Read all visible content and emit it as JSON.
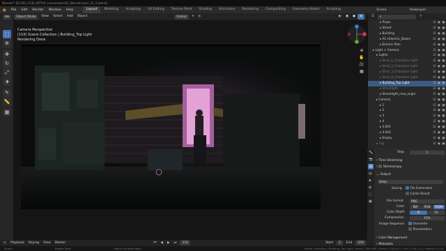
{
  "titlebar": "Blender* [D:\\3D_CG\\B_ARTS\\P_Lemontown\\02_Blender\\Lem_01_5.blend]",
  "menu": [
    "File",
    "Edit",
    "Render",
    "Window",
    "Help"
  ],
  "workspaces": [
    "Layout",
    "Modeling",
    "Sculpting",
    "UV Editing",
    "Texture Paint",
    "Shading",
    "Animation",
    "Rendering",
    "Compositing",
    "Geometry Nodes",
    "Scripting"
  ],
  "active_workspace": "Layout",
  "scene": "Scene",
  "view_layer": "ViewLayer",
  "viewport_header": {
    "mode": "Object Mode",
    "view": "View",
    "select": "Select",
    "add": "Add",
    "object": "Object",
    "orientation": "Global",
    "options": "Options"
  },
  "overlay": {
    "line1": "Camera Perspective",
    "line2": "(110) Scene Collection | Building_Top Light",
    "line3": "Rendering Done"
  },
  "timeline": {
    "playback": "Playback",
    "keying": "Keying",
    "view": "View",
    "marker": "Marker",
    "start_label": "Start",
    "start": "1",
    "end_label": "End",
    "end": "250",
    "current": "110"
  },
  "statusbar": {
    "left": "Select",
    "mid": "Rotate View",
    "mid2": "Object Context Menu",
    "right": "Scene Collection | Building_Top Light | Verts:1,369,485 | Faces:1,258,047 | Tris:2,516,124 | Objects:1/118"
  },
  "outliner": {
    "rows": [
      {
        "name": "Props",
        "indent": 3,
        "state": ""
      },
      {
        "name": "Street",
        "indent": 3,
        "state": ""
      },
      {
        "name": "Building",
        "indent": 3,
        "state": ""
      },
      {
        "name": "AC+Electric_Boxes",
        "indent": 3,
        "state": ""
      },
      {
        "name": "Electric Pole",
        "indent": 3,
        "state": ""
      },
      {
        "name": "Light + Camera",
        "indent": 1,
        "state": ""
      },
      {
        "name": "Lights",
        "indent": 2,
        "state": ""
      },
      {
        "name": "Strut_1_Character Light",
        "indent": 3,
        "state": "dim"
      },
      {
        "name": "Strut_2_Character Light",
        "indent": 3,
        "state": "dim"
      },
      {
        "name": "Strut_3_Character Light",
        "indent": 3,
        "state": "dim"
      },
      {
        "name": "Strut_4_Character Light",
        "indent": 3,
        "state": "dim"
      },
      {
        "name": "Building_Top Light",
        "indent": 3,
        "state": "sel"
      },
      {
        "name": "Streetlight",
        "indent": 3,
        "state": "dim"
      },
      {
        "name": "Streetlight_new_angle",
        "indent": 3,
        "state": ""
      },
      {
        "name": "Camera",
        "indent": 2,
        "state": ""
      },
      {
        "name": "1",
        "indent": 3,
        "state": ""
      },
      {
        "name": "2",
        "indent": 3,
        "state": ""
      },
      {
        "name": "3",
        "indent": 3,
        "state": ""
      },
      {
        "name": "4",
        "indent": 3,
        "state": ""
      },
      {
        "name": "4.001",
        "indent": 3,
        "state": ""
      },
      {
        "name": "4.002",
        "indent": 3,
        "state": ""
      },
      {
        "name": "Empty",
        "indent": 3,
        "state": ""
      },
      {
        "name": "Fog",
        "indent": 2,
        "state": "dim"
      }
    ]
  },
  "properties": {
    "step_label": "Step",
    "step_value": "1",
    "time_stretching": "Time Stretching",
    "stereoscopy": "Stereoscopy",
    "output": "Output",
    "path": "/tmp\\",
    "saving_label": "Saving",
    "file_extensions": "File Extensions",
    "cache_result": "Cache Result",
    "file_format_label": "File Format",
    "file_format": "PNG",
    "color_label": "Color",
    "color_opts": [
      "BW",
      "RGB",
      "RGBA"
    ],
    "color_active": "RGBA",
    "depth_label": "Color Depth",
    "depth_opts": [
      "8",
      "16"
    ],
    "depth_active": "8",
    "compression_label": "Compression",
    "compression": "15%",
    "image_sequence_label": "Image Sequence",
    "overwrite": "Overwrite",
    "placeholders": "Placeholders",
    "color_management": "Color Management",
    "metadata": "Metadata"
  }
}
